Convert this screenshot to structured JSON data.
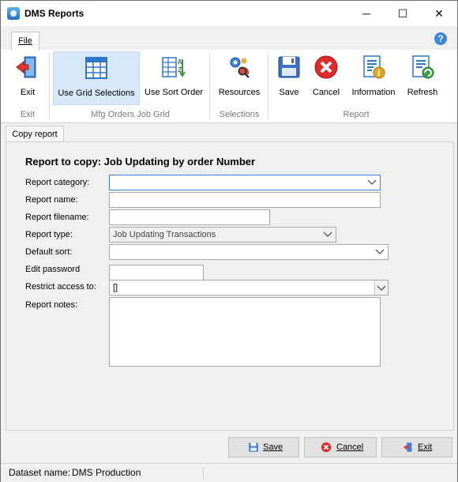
{
  "window": {
    "title": "DMS Reports",
    "minimize": "─",
    "maximize": "☐",
    "close": "✕"
  },
  "ribbon_tabs": {
    "file": "File",
    "help": "?"
  },
  "ribbon": {
    "exit": "Exit",
    "use_grid_selections": "Use Grid Selections",
    "use_sort_order": "Use Sort Order",
    "resources": "Resources",
    "save": "Save",
    "cancel": "Cancel",
    "information": "Information",
    "refresh": "Refresh",
    "groups": {
      "exit": "Exit",
      "grid": "Mfg Orders Job Grid",
      "selections": "Selections",
      "report": "Report"
    }
  },
  "tab": {
    "label": "Copy report"
  },
  "form": {
    "heading": "Report to copy: Job Updating by order Number",
    "labels": {
      "category": "Report category:",
      "name": "Report name:",
      "filename": "Report filename:",
      "type": "Report type:",
      "default_sort": "Default sort:",
      "password": "Edit password",
      "restrict": "Restrict access to:",
      "notes": "Report notes:"
    },
    "values": {
      "category": "",
      "name": "",
      "filename": "",
      "type": "Job Updating Transactions",
      "default_sort": "",
      "password": "",
      "restrict": "[]",
      "notes": ""
    }
  },
  "buttons": {
    "save": "Save",
    "cancel": "Cancel",
    "exit": "Exit"
  },
  "status": {
    "dataset_label": "Dataset name:",
    "dataset_value": "DMS Production"
  }
}
